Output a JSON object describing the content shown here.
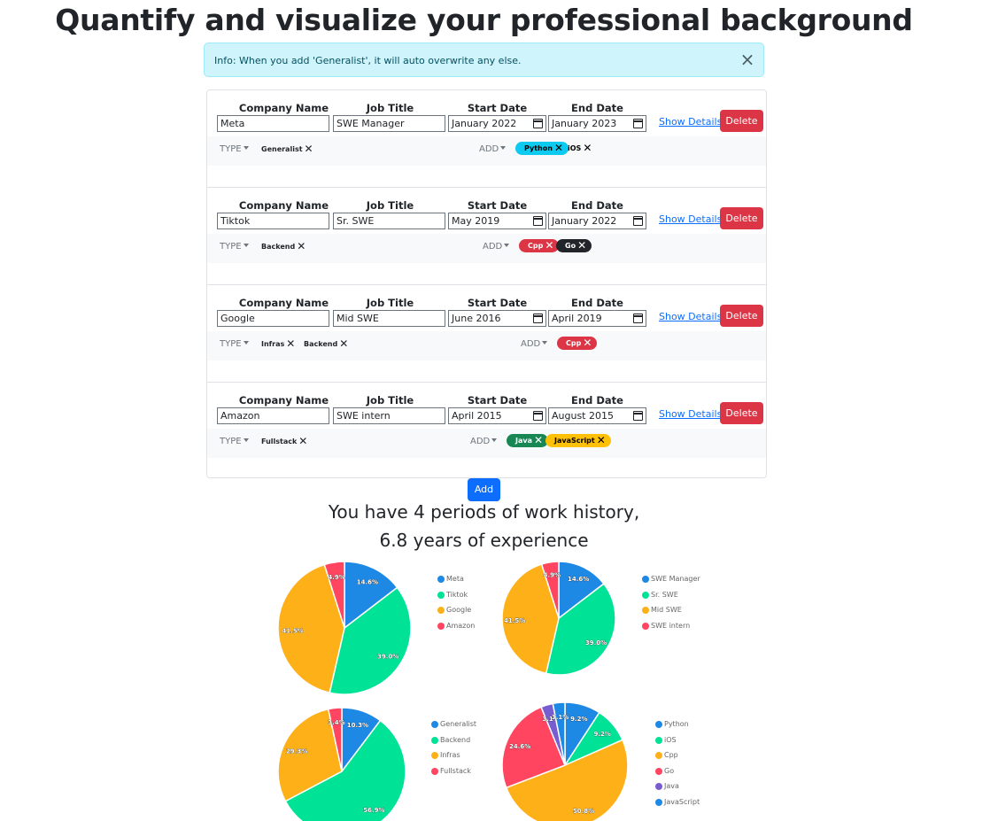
{
  "title": "Quantify and visualize your professional background",
  "alert": {
    "text": "Info: When you add 'Generalist', it will auto overwrite any else.",
    "close_icon": "close-icon"
  },
  "headers": {
    "company": "Company Name",
    "job": "Job Title",
    "start": "Start Date",
    "end": "End Date"
  },
  "labels": {
    "show_details": "Show Details",
    "delete": "Delete",
    "type": "TYPE",
    "add_skill": "ADD",
    "add_button": "Add"
  },
  "jobs": [
    {
      "company": "Meta",
      "title": "SWE Manager",
      "start": "January 2022",
      "end": "January 2023",
      "types": [
        "Generalist"
      ],
      "skills": [
        {
          "name": "Python",
          "color": "#0dcaf0",
          "text_color": "#000000"
        },
        {
          "name": "iOS",
          "color": "",
          "text_color": "#000000"
        }
      ]
    },
    {
      "company": "Tiktok",
      "title": "Sr. SWE",
      "start": "May 2019",
      "end": "January 2022",
      "types": [
        "Backend"
      ],
      "skills": [
        {
          "name": "Cpp",
          "color": "#dc3545",
          "text_color": "#ffffff"
        },
        {
          "name": "Go",
          "color": "#212529",
          "text_color": "#ffffff"
        }
      ]
    },
    {
      "company": "Google",
      "title": "Mid SWE",
      "start": "June 2016",
      "end": "April 2019",
      "types": [
        "Infras",
        "Backend"
      ],
      "skills": [
        {
          "name": "Cpp",
          "color": "#dc3545",
          "text_color": "#ffffff"
        }
      ]
    },
    {
      "company": "Amazon",
      "title": "SWE intern",
      "start": "April 2015",
      "end": "August 2015",
      "types": [
        "Fullstack"
      ],
      "skills": [
        {
          "name": "Java",
          "color": "#198754",
          "text_color": "#ffffff"
        },
        {
          "name": "JavaScript",
          "color": "#ffc107",
          "text_color": "#000000"
        }
      ]
    }
  ],
  "summary": {
    "line1": "You have 4 periods of work history,",
    "line2": "6.8 years of experience"
  },
  "chart_data": [
    {
      "type": "pie",
      "categories": [
        "Meta",
        "Tiktok",
        "Google",
        "Amazon"
      ],
      "values": [
        14.6,
        39.0,
        41.5,
        4.9
      ],
      "labels": [
        "14.6%",
        "39.0%",
        "41.5%",
        "4.9%"
      ],
      "colors": [
        "#1e88e5",
        "#00e396",
        "#feb019",
        "#ff4560"
      ],
      "legend": "right"
    },
    {
      "type": "pie",
      "categories": [
        "SWE Manager",
        "Sr. SWE",
        "Mid SWE",
        "SWE intern"
      ],
      "values": [
        14.6,
        39.0,
        41.5,
        4.9
      ],
      "labels": [
        "14.6%",
        "39.0%",
        "41.5%",
        "4.9%"
      ],
      "colors": [
        "#1e88e5",
        "#00e396",
        "#feb019",
        "#ff4560"
      ],
      "legend": "right"
    },
    {
      "type": "pie",
      "categories": [
        "Generalist",
        "Backend",
        "Infras",
        "Fullstack"
      ],
      "values": [
        10.3,
        56.9,
        29.3,
        3.4
      ],
      "labels": [
        "10.3%",
        "56.9%",
        "29.3%",
        "3.4%"
      ],
      "colors": [
        "#1e88e5",
        "#00e396",
        "#feb019",
        "#ff4560"
      ],
      "legend": "right"
    },
    {
      "type": "pie",
      "categories": [
        "Python",
        "iOS",
        "Cpp",
        "Go",
        "Java",
        "JavaScript"
      ],
      "values": [
        9.2,
        9.2,
        50.8,
        24.6,
        3.1,
        3.1
      ],
      "labels": [
        "9.2%",
        "9.2%",
        "50.8%",
        "24.6%",
        "3.1%",
        "3.1%"
      ],
      "colors": [
        "#1e88e5",
        "#00e396",
        "#feb019",
        "#ff4560",
        "#775dd0",
        "#1e88e5"
      ],
      "legend": "right"
    }
  ]
}
